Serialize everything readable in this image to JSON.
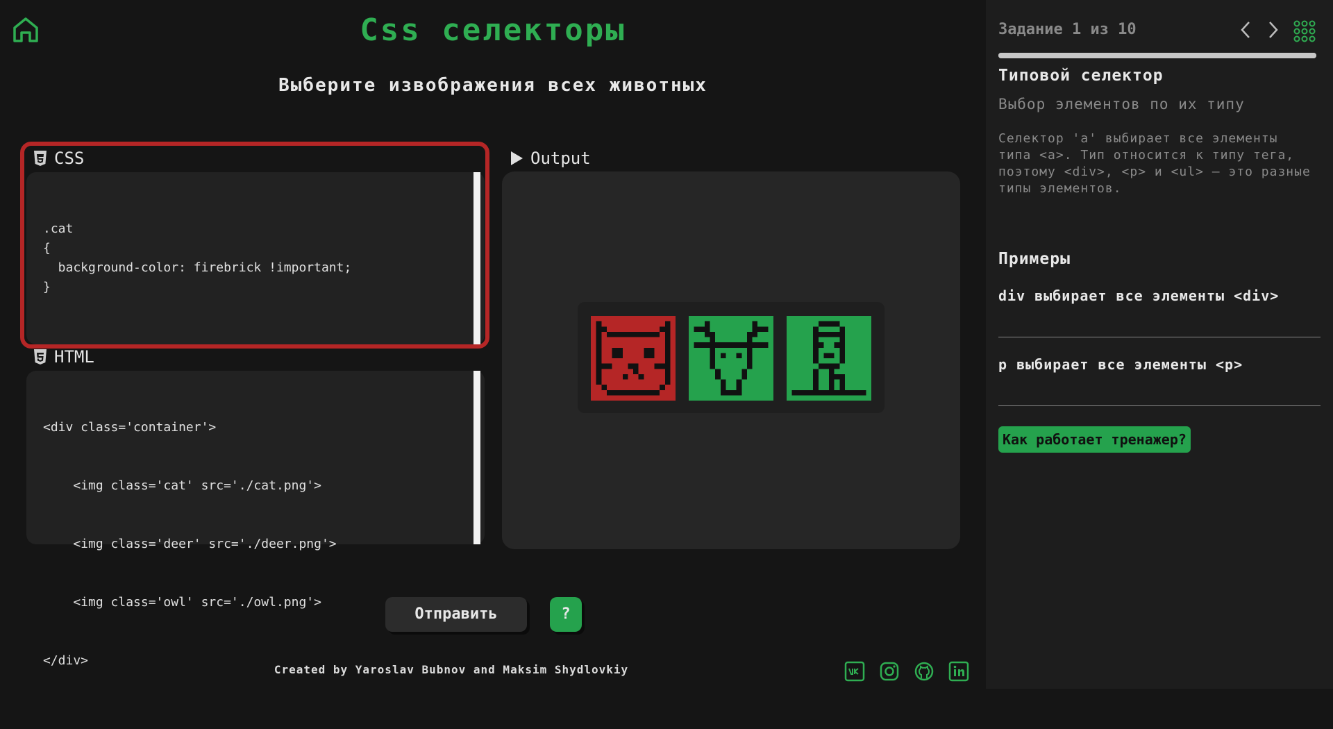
{
  "header": {
    "title": "Css селекторы",
    "task": "Выберите извображения всех животных"
  },
  "editor": {
    "css_label": "CSS",
    "css_code": ".cat\n{\n  background-color: firebrick !important;\n}",
    "html_label": "HTML",
    "html_lines": [
      "<div class='container'>",
      "    <img class='cat' src='./cat.png'>",
      "    <img class='deer' src='./deer.png'>",
      "    <img class='owl' src='./owl.png'>",
      "</div>"
    ]
  },
  "output": {
    "label": "Output",
    "animals": [
      {
        "name": "cat",
        "bg": "#b52626"
      },
      {
        "name": "deer",
        "bg": "#25a24d"
      },
      {
        "name": "owl",
        "bg": "#25a24d"
      }
    ]
  },
  "actions": {
    "submit_label": "Отправить",
    "help_label": "?"
  },
  "footer": {
    "credits": "Created by Yaroslav Bubnov and Maksim Shydlovkiy",
    "socials": [
      "vk-icon",
      "instagram-icon",
      "github-icon",
      "linkedin-icon"
    ]
  },
  "sidebar": {
    "level_text": "Задание 1 из 10",
    "progress_fraction": 0.1,
    "selector_title": "Типовой селектор",
    "selector_subtitle": "Выбор элементов по их типу",
    "description": "Селектор 'a' выбирает все элементы типа <a>. Тип относится к типу тега, поэтому <div>, <p> и <ul> — это разные типы элементов.",
    "examples_title": "Примеры",
    "examples": [
      "div выбирает все элементы <div>",
      "p выбирает все элементы <p>"
    ],
    "how_button": "Как работает тренажер?"
  },
  "colors": {
    "accent": "#2fae52",
    "highlight_border": "#b52626",
    "background": "#151515",
    "sidebar": "#1d1d1d"
  }
}
